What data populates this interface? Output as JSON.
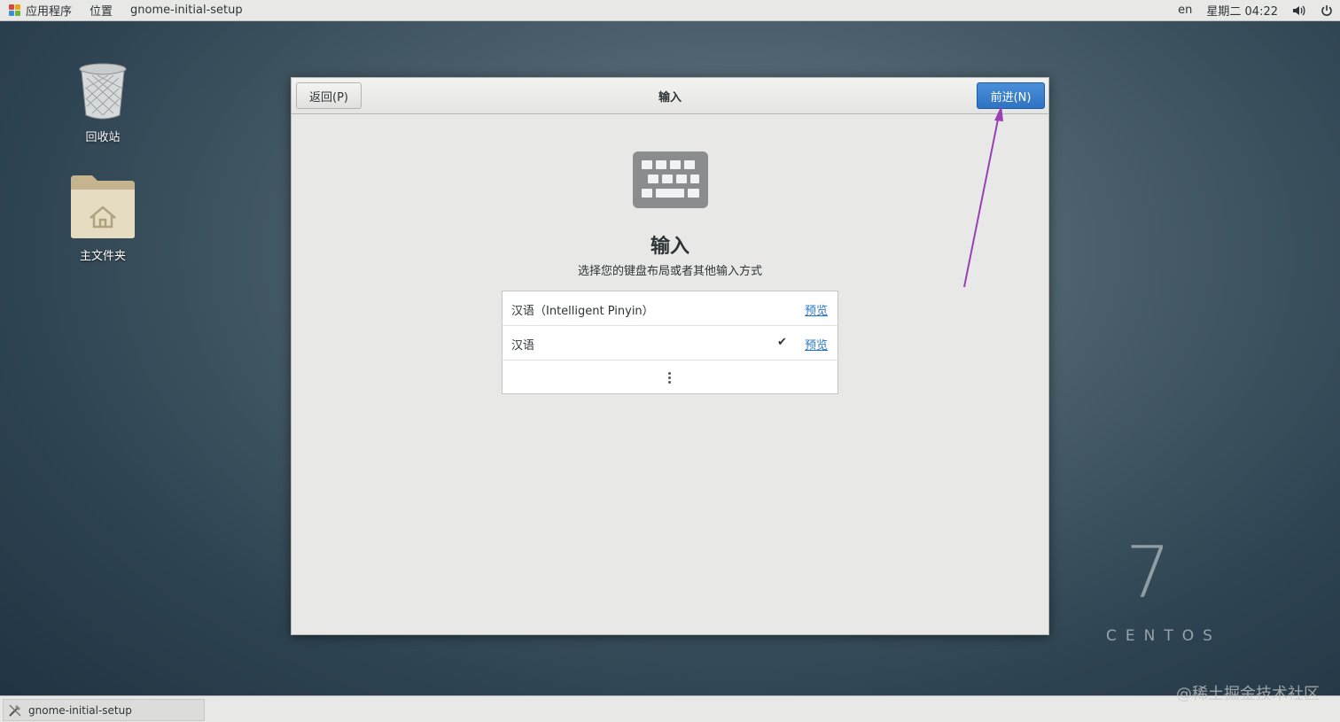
{
  "topbar": {
    "applications": "应用程序",
    "places": "位置",
    "app_title": "gnome-initial-setup",
    "language": "en",
    "clock": "星期二 04:22"
  },
  "desktop": {
    "trash_label": "回收站",
    "home_label": "主文件夹"
  },
  "dialog": {
    "back_label": "返回(P)",
    "title": "输入",
    "next_label": "前进(N)",
    "heading": "输入",
    "subheading": "选择您的键盘布局或者其他输入方式",
    "sources": [
      {
        "name": "汉语（Intelligent Pinyin）",
        "preview": "预览",
        "selected": false
      },
      {
        "name": "汉语",
        "preview": "预览",
        "selected": true
      }
    ]
  },
  "branding": {
    "version": "7",
    "name": "CENTOS"
  },
  "taskbar": {
    "item_label": "gnome-initial-setup"
  },
  "watermark": "@稀土掘金技术社区",
  "colors": {
    "accent": "#2f74c3",
    "link": "#2a76c6",
    "annotation": "#9b3fb5"
  }
}
